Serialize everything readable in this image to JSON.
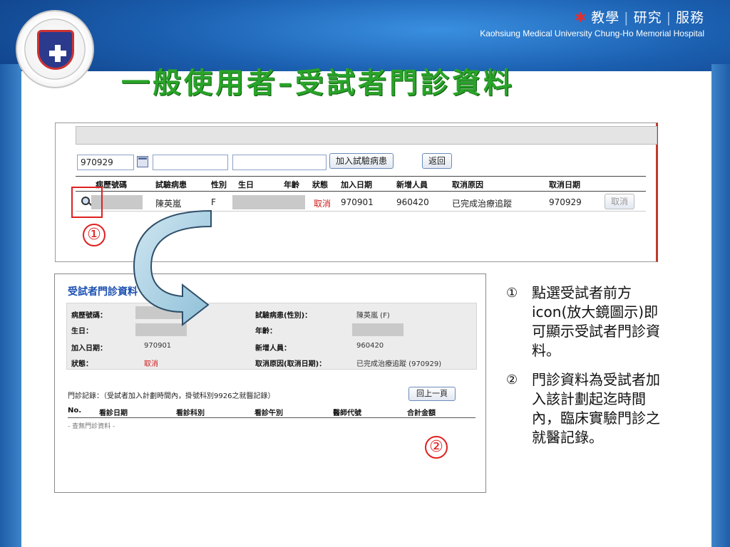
{
  "header": {
    "motto": [
      "教學",
      "研究",
      "服務"
    ],
    "hospital_en": "Kaohsiung Medical University  Chung-Ho Memorial Hospital",
    "title": "一般使用者–受試者門診資料"
  },
  "panel1": {
    "date_input": "970929",
    "add_button": "加入試驗病患",
    "back_button": "返回",
    "columns": [
      "病歷號碼",
      "試驗病患",
      "性別",
      "生日",
      "年齡",
      "狀態",
      "加入日期",
      "新增人員",
      "取消原因",
      "取消日期"
    ],
    "row": {
      "name": "陳英嵐",
      "gender": "F",
      "status": "取消",
      "join_date": "970901",
      "added_by": "960420",
      "cancel_reason": "已完成治療追蹤",
      "cancel_date": "970929",
      "cancel_button": "取消"
    },
    "marker": "①"
  },
  "panel2": {
    "title": "受試者門診資料",
    "labels": {
      "chart_no": "病歷號碼：",
      "patient": "試驗病患(性別)：",
      "birthday": "生日：",
      "age": "年齡：",
      "join_date": "加入日期：",
      "added_by": "新增人員：",
      "status": "狀態：",
      "cancel": "取消原因(取消日期)："
    },
    "values": {
      "patient": "陳英嵐 (F)",
      "join_date": "970901",
      "added_by": "960420",
      "status": "取消",
      "cancel": "已完成治療追蹤 (970929)"
    },
    "visit_title": "門診記錄：（受試者加入計劃時間內，掛號科別9926之就醫記錄）",
    "prev_button": "回上一頁",
    "visit_columns": [
      "No.",
      "看診日期",
      "看診科別",
      "看診午別",
      "醫師代號",
      "合計金額"
    ],
    "no_data": "- 查無門診資料 -",
    "marker": "②"
  },
  "notes": [
    {
      "num": "①",
      "text": "點選受試者前方icon(放大鏡圖示)即可顯示受試者門診資料。"
    },
    {
      "num": "②",
      "text": "門診資料為受試者加入該計劃起迄時間內，臨床實驗門診之就醫記錄。"
    }
  ]
}
